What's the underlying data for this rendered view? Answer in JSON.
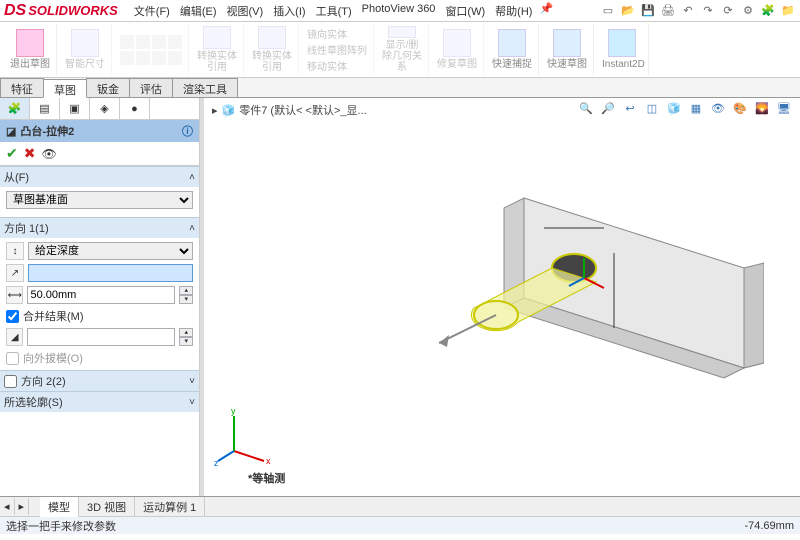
{
  "app": {
    "brand": "SOLIDWORKS"
  },
  "menu": {
    "file": "文件(F)",
    "edit": "编辑(E)",
    "view": "视图(V)",
    "insert": "插入(I)",
    "tools": "工具(T)",
    "pv360": "PhotoView 360",
    "window": "窗口(W)",
    "help": "帮助(H)"
  },
  "ribbon": {
    "exit_sketch": "退出草图",
    "smart_dim": "智能尺寸",
    "convert_ent": "转换实体引用",
    "offset_ent": "转换实体引用",
    "mirror_ent": "镜向实体",
    "linear_pattern": "线性草图阵列",
    "move_ent": "移动实体",
    "display_del": "显示/删除几何关系",
    "repair": "修复草图",
    "quick_snap": "快速捕捉",
    "rapid_sketch": "快速草图",
    "instant2d": "Instant2D"
  },
  "tabs": {
    "feature": "特征",
    "sketch": "草图",
    "sheetmetal": "钣金",
    "evaluate": "评估",
    "render": "渲染工具"
  },
  "feature": {
    "name": "凸台-拉伸2",
    "from_label": "从(F)",
    "from_value": "草图基准面",
    "dir1_label": "方向 1(1)",
    "end_cond": "给定深度",
    "depth_input": "",
    "depth_value": "50.00mm",
    "merge": "合并结果(M)",
    "draft_outward": "向外拔模(O)",
    "dir2_label": "方向 2(2)",
    "contours_label": "所选轮廓(S)"
  },
  "breadcrumb": {
    "part": "零件7  (默认< <默认>_显..."
  },
  "viewport": {
    "orientation_label": "*等轴测"
  },
  "bottom_tabs": {
    "model": "模型",
    "view3d": "3D 视图",
    "motion": "运动算例 1"
  },
  "status": {
    "message": "选择一把手来修改参数",
    "measurement": "-74.69mm"
  }
}
